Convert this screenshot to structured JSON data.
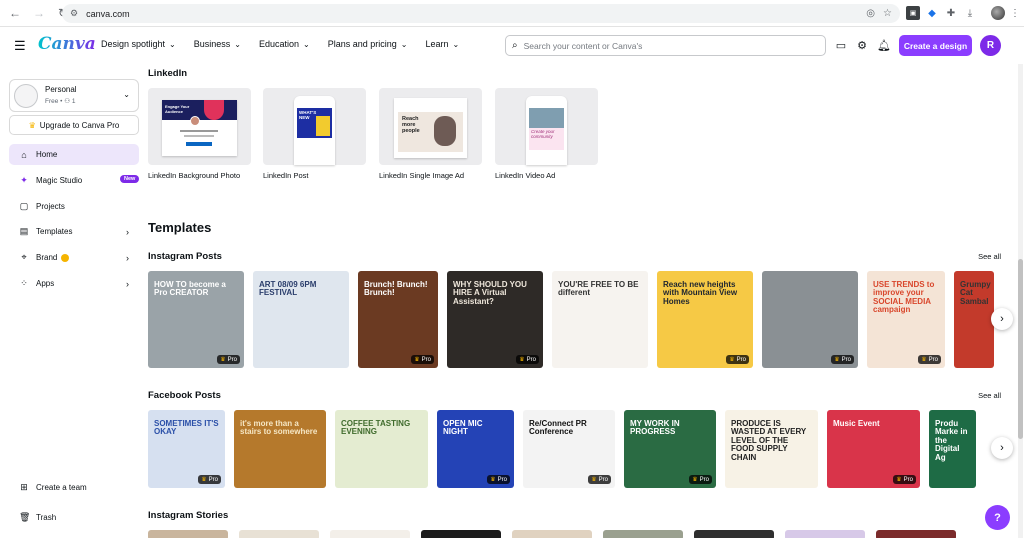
{
  "browser": {
    "url": "canva.com"
  },
  "header": {
    "logo": "Canva",
    "nav": [
      "Design spotlight",
      "Business",
      "Education",
      "Plans and pricing",
      "Learn"
    ],
    "search_placeholder": "Search your content or Canva's",
    "create_button": "Create a design",
    "avatar_initial": "R"
  },
  "sidebar": {
    "account_name": "Personal",
    "account_plan": "Free • ⚇ 1",
    "upgrade": "Upgrade to Canva Pro",
    "items": [
      {
        "label": "Home",
        "icon": "home-icon"
      },
      {
        "label": "Magic Studio",
        "icon": "sparkle-icon",
        "badge": "New"
      },
      {
        "label": "Projects",
        "icon": "folder-icon"
      },
      {
        "label": "Templates",
        "icon": "templates-icon"
      },
      {
        "label": "Brand",
        "icon": "brand-icon"
      },
      {
        "label": "Apps",
        "icon": "apps-icon"
      }
    ],
    "bottom": [
      {
        "label": "Create a team",
        "icon": "team-icon"
      },
      {
        "label": "Trash",
        "icon": "trash-icon"
      }
    ]
  },
  "main": {
    "linkedin_title": "LinkedIn",
    "linkedin_cards": [
      {
        "label": "LinkedIn Background Photo",
        "mock_text": "Engage Your Audience"
      },
      {
        "label": "LinkedIn Post",
        "mock_text": "WHAT'S NEW"
      },
      {
        "label": "LinkedIn Single Image Ad",
        "mock_text": "Reach more people"
      },
      {
        "label": "LinkedIn Video Ad",
        "mock_text": "Create your community"
      }
    ],
    "templates_title": "Templates",
    "see_all": "See all",
    "instagram_title": "Instagram Posts",
    "instagram_tiles": [
      {
        "text": "HOW TO become a Pro CREATOR",
        "pro": true,
        "bg": "#9aa3a8"
      },
      {
        "text": "ART 08/09 6PM FESTIVAL",
        "pro": false,
        "bg": "#dfe6ee"
      },
      {
        "text": "Brunch! Brunch! Brunch!",
        "pro": true,
        "bg": "#6b3a22"
      },
      {
        "text": "WHY SHOULD YOU HIRE A Virtual Assistant?",
        "pro": true,
        "bg": "#2e2a27"
      },
      {
        "text": "YOU'RE FREE TO BE different",
        "pro": false,
        "bg": "#f6f3ef"
      },
      {
        "text": "Reach new heights with Mountain View Homes",
        "pro": true,
        "bg": "#f6c945"
      },
      {
        "text": "",
        "pro": true,
        "bg": "#8a9094"
      },
      {
        "text": "USE TRENDS to improve your SOCIAL MEDIA campaign",
        "pro": true,
        "bg": "#f4e4d6"
      },
      {
        "text": "Grumpy Cat Sambal",
        "pro": false,
        "bg": "#c33a2b"
      }
    ],
    "pro_label": "Pro",
    "facebook_title": "Facebook Posts",
    "facebook_tiles": [
      {
        "text": "SOMETIMES IT'S OKAY",
        "pro": true,
        "bg": "#d6e0f0"
      },
      {
        "text": "it's more than a stairs to somewhere",
        "pro": false,
        "bg": "#b5792c"
      },
      {
        "text": "COFFEE TASTING EVENING",
        "pro": false,
        "bg": "#e4ecd1"
      },
      {
        "text": "OPEN MIC NIGHT",
        "pro": true,
        "bg": "#2443b6"
      },
      {
        "text": "Re/Connect PR Conference",
        "pro": true,
        "bg": "#f3f3f3"
      },
      {
        "text": "MY WORK IN PROGRESS",
        "pro": true,
        "bg": "#2a6b43"
      },
      {
        "text": "PRODUCE IS WASTED AT EVERY LEVEL OF THE FOOD SUPPLY CHAIN",
        "pro": false,
        "bg": "#f7f2e6"
      },
      {
        "text": "Music Event",
        "pro": true,
        "bg": "#d9344a"
      },
      {
        "text": "Produ Marke in the Digital Ag",
        "pro": false,
        "bg": "#1e6b45"
      }
    ],
    "stories_title": "Instagram Stories",
    "stories_see_all": "Se"
  }
}
